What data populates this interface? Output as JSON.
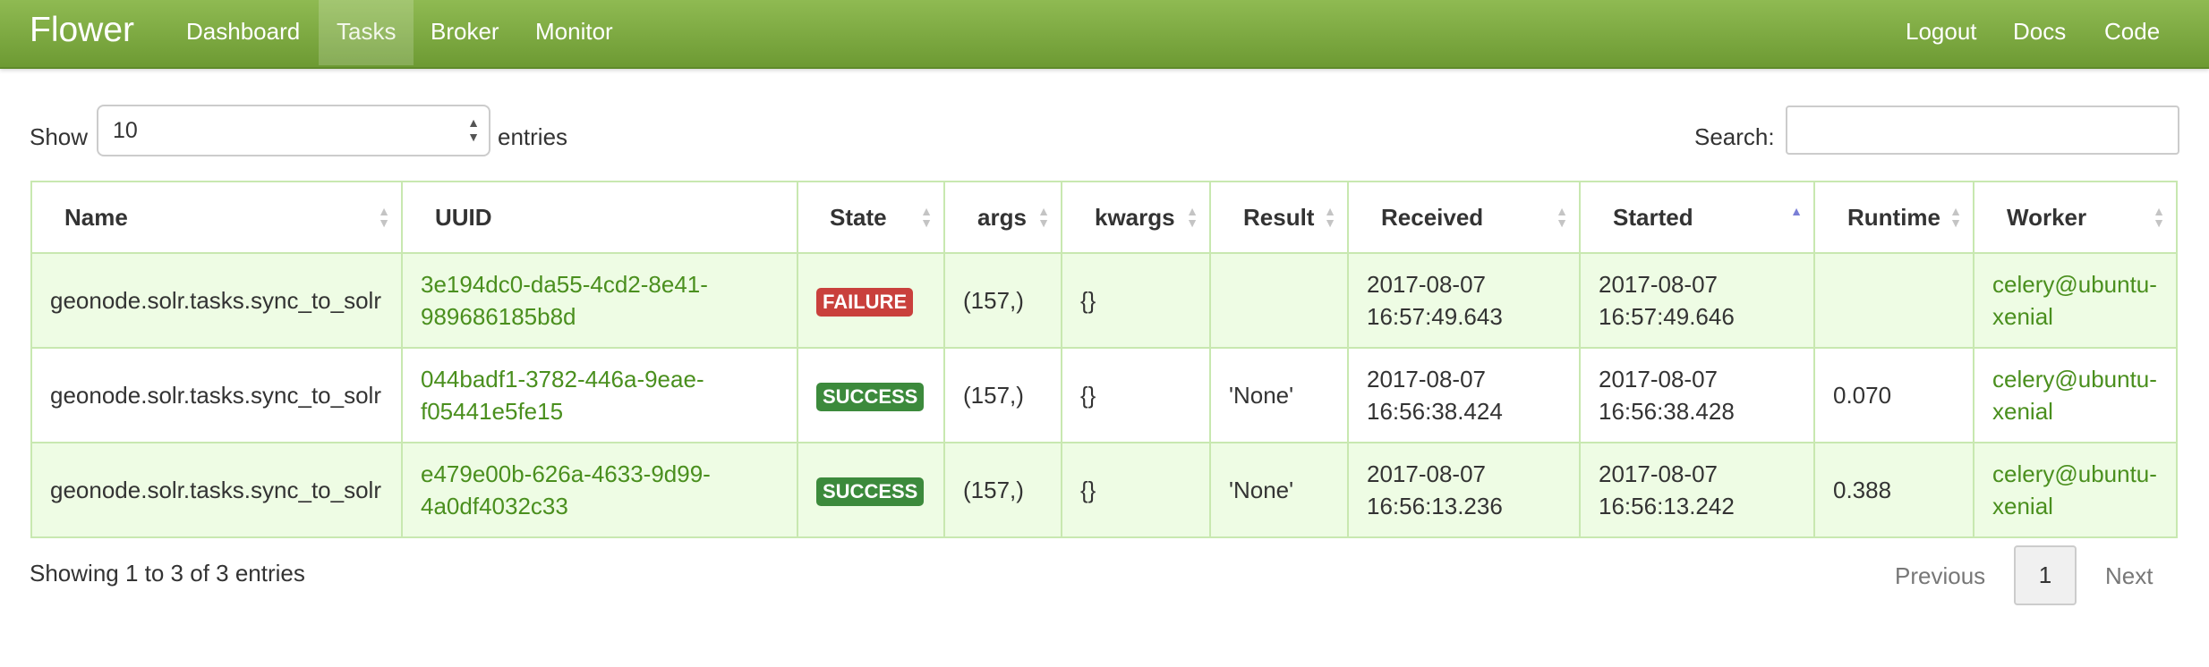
{
  "brand": "Flower",
  "nav": {
    "left": [
      "Dashboard",
      "Tasks",
      "Broker",
      "Monitor"
    ],
    "right": [
      "Logout",
      "Docs",
      "Code"
    ],
    "active": "Tasks"
  },
  "controls": {
    "show_label": "Show",
    "entries_value": "10",
    "entries_label": "entries",
    "search_label": "Search:",
    "search_value": ""
  },
  "table": {
    "columns": [
      "Name",
      "UUID",
      "State",
      "args",
      "kwargs",
      "Result",
      "Received",
      "Started",
      "Runtime",
      "Worker"
    ],
    "sorted_column": "Started",
    "rows": [
      {
        "name": "geonode.solr.tasks.sync_to_solr",
        "uuid": [
          "3e194dc0-da55-4cd2-8e41-",
          "989686185b8d"
        ],
        "state": "FAILURE",
        "args": "(157,)",
        "kwargs": "{}",
        "result": "",
        "received": [
          "2017-08-07",
          "16:57:49.643"
        ],
        "started": [
          "2017-08-07",
          "16:57:49.646"
        ],
        "runtime": "",
        "worker": [
          "celery@ubuntu-",
          "xenial"
        ]
      },
      {
        "name": "geonode.solr.tasks.sync_to_solr",
        "uuid": [
          "044badf1-3782-446a-9eae-",
          "f05441e5fe15"
        ],
        "state": "SUCCESS",
        "args": "(157,)",
        "kwargs": "{}",
        "result": "'None'",
        "received": [
          "2017-08-07",
          "16:56:38.424"
        ],
        "started": [
          "2017-08-07",
          "16:56:38.428"
        ],
        "runtime": "0.070",
        "worker": [
          "celery@ubuntu-",
          "xenial"
        ]
      },
      {
        "name": "geonode.solr.tasks.sync_to_solr",
        "uuid": [
          "e479e00b-626a-4633-9d99-",
          "4a0df4032c33"
        ],
        "state": "SUCCESS",
        "args": "(157,)",
        "kwargs": "{}",
        "result": "'None'",
        "received": [
          "2017-08-07",
          "16:56:13.236"
        ],
        "started": [
          "2017-08-07",
          "16:56:13.242"
        ],
        "runtime": "0.388",
        "worker": [
          "celery@ubuntu-",
          "xenial"
        ]
      }
    ]
  },
  "footer": {
    "info": "Showing 1 to 3 of 3 entries",
    "previous": "Previous",
    "page": "1",
    "next": "Next"
  },
  "colors": {
    "navbar": "#7aa83e",
    "link": "#4a8f1e",
    "failure": "#c9403c",
    "success": "#3c8a3c",
    "row_odd": "#eefce4"
  }
}
